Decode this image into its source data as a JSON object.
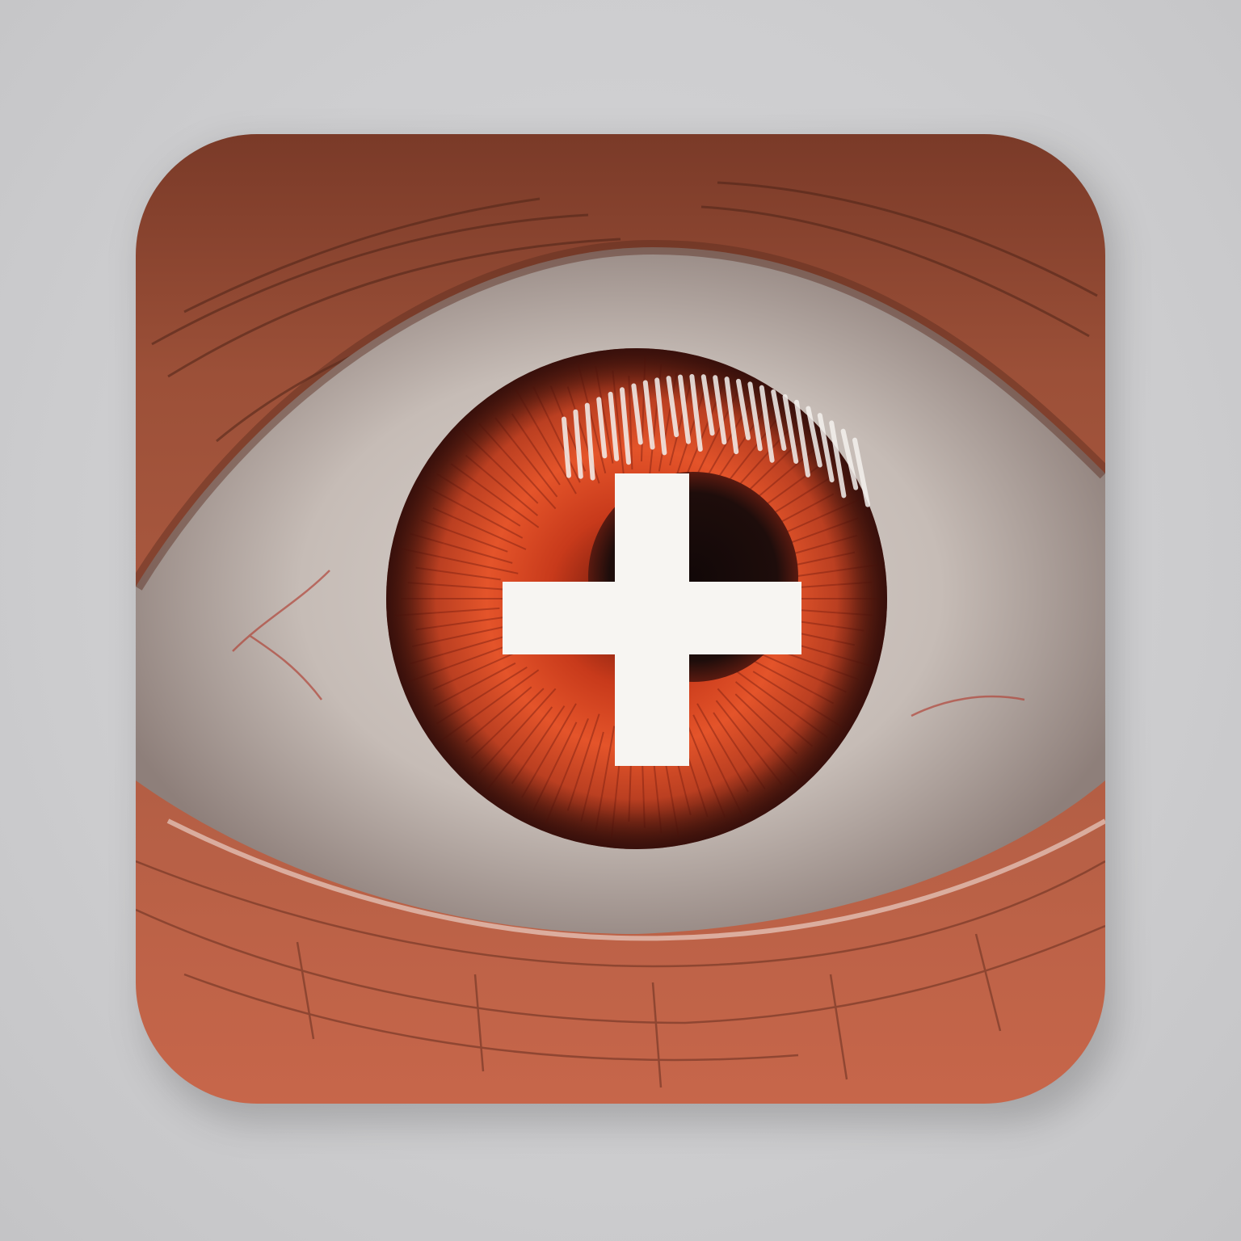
{
  "icon": {
    "name": "eye-medical-cross-icon",
    "colors": {
      "background": "#cecfd0",
      "skin": "#a3523d",
      "skin_dark": "#6e2f20",
      "sclera": "#c9c3bf",
      "iris_outer": "#a32a14",
      "iris_inner": "#e0461f",
      "pupil": "#1a0d0c",
      "cross": "#f7f5f2"
    }
  }
}
